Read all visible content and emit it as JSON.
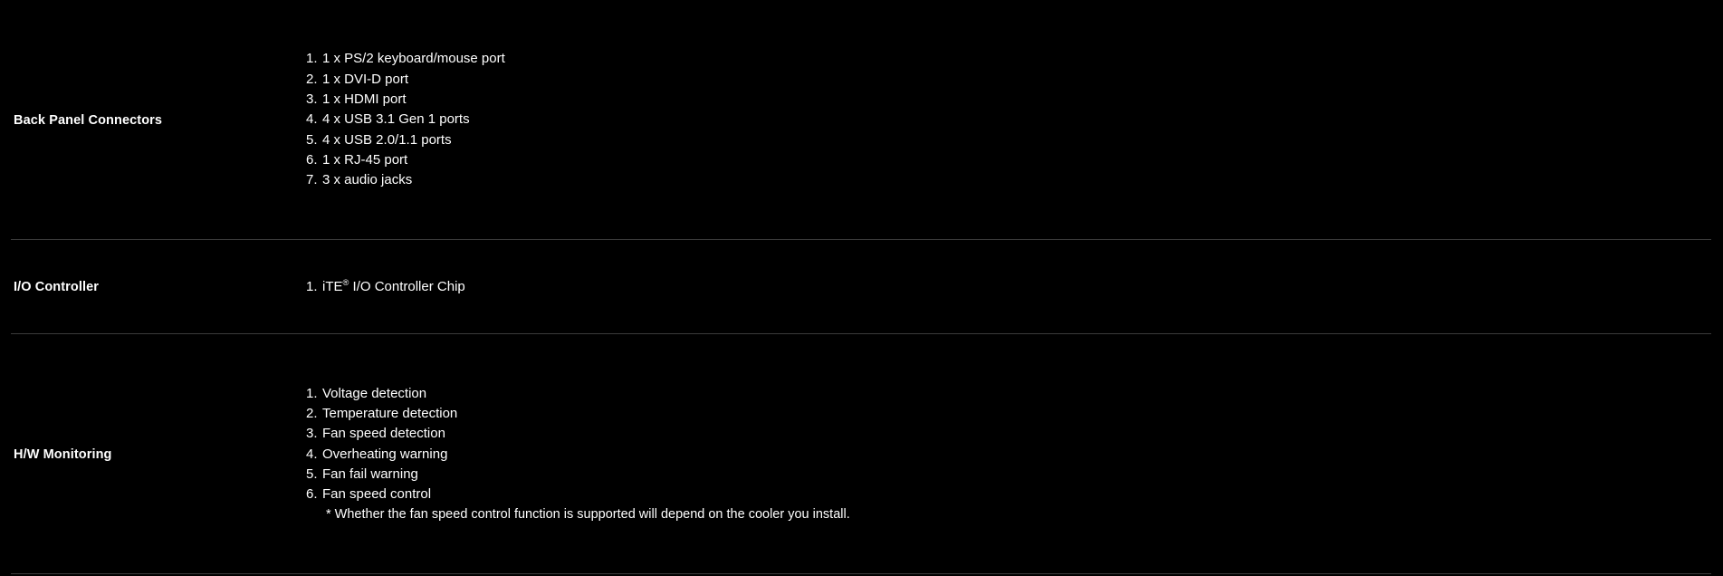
{
  "spec_table": {
    "rows": [
      {
        "label": "Back Panel Connectors",
        "items": [
          {
            "num": "1.",
            "text": "1 x PS/2 keyboard/mouse port"
          },
          {
            "num": "2.",
            "text": "1 x DVI-D port"
          },
          {
            "num": "3.",
            "text": "1 x HDMI port"
          },
          {
            "num": "4.",
            "text": "4 x USB 3.1 Gen 1 ports"
          },
          {
            "num": "5.",
            "text": "4 x USB 2.0/1.1 ports"
          },
          {
            "num": "6.",
            "text": "1 x RJ-45 port"
          },
          {
            "num": "7.",
            "text": "3 x audio jacks"
          }
        ],
        "footnote": ""
      },
      {
        "label": "I/O Controller",
        "items": [
          {
            "num": "1.",
            "text_before_sup": "iTE",
            "sup": "®",
            "text_after_sup": " I/O Controller Chip"
          }
        ],
        "footnote": ""
      },
      {
        "label": "H/W Monitoring",
        "items": [
          {
            "num": "1.",
            "text": "Voltage detection"
          },
          {
            "num": "2.",
            "text": "Temperature detection"
          },
          {
            "num": "3.",
            "text": "Fan speed detection"
          },
          {
            "num": "4.",
            "text": "Overheating warning"
          },
          {
            "num": "5.",
            "text": "Fan fail warning"
          },
          {
            "num": "6.",
            "text": "Fan speed control"
          }
        ],
        "footnote": "* Whether the fan speed control function is supported will depend on the cooler you install."
      }
    ]
  },
  "colors": {
    "background": "#000000",
    "text": "#ffffff",
    "divider": "#3c3c3c"
  }
}
